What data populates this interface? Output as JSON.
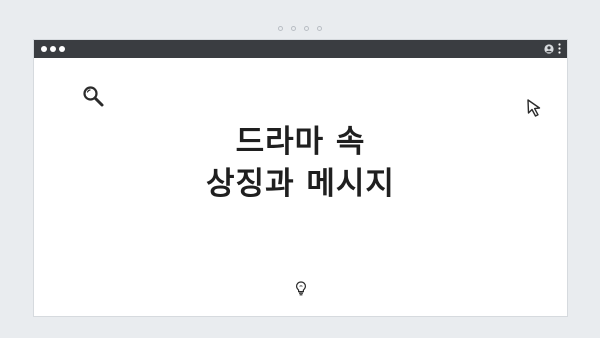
{
  "window": {
    "titlebar": {
      "controls": [
        "dot",
        "dot",
        "dot"
      ],
      "right_icons": [
        "user-icon",
        "kebab-menu-icon"
      ]
    }
  },
  "pager": {
    "dots": 4
  },
  "content": {
    "headline_line1": "드라마 속",
    "headline_line2": "상징과 메시지",
    "icons": [
      "search-icon",
      "cursor-icon",
      "lightbulb-icon"
    ]
  },
  "colors": {
    "background": "#e9ecef",
    "titlebar": "#3a3d41",
    "window": "#ffffff",
    "text": "#1f1f1f"
  }
}
